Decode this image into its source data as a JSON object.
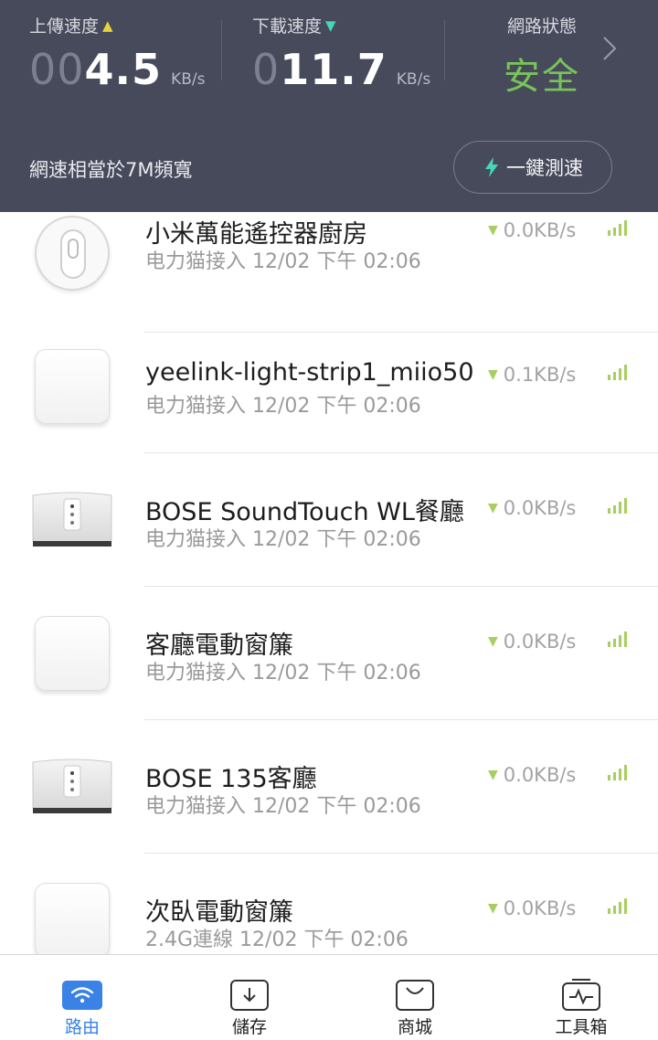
{
  "header": {
    "upload": {
      "label": "上傳速度",
      "value_dim": "00",
      "value": "4.5",
      "unit": "KB/s"
    },
    "download": {
      "label": "下載速度",
      "value_dim": "0",
      "value": "11.7",
      "unit": "KB/s"
    },
    "network": {
      "label": "網路狀態",
      "status": "安全"
    },
    "bandwidth_text": "網速相當於7M頻寬",
    "speedtest_label": "一鍵測速"
  },
  "devices": [
    {
      "name": "小米萬能遙控器廚房",
      "connection": "电力猫接入",
      "time": "12/02 下午 02:06",
      "speed": "0.0KB/s",
      "icon": "remote-icon"
    },
    {
      "name": "yeelink-light-strip1_miio50…",
      "connection": "电力猫接入",
      "time": "12/02 下午 02:06",
      "speed": "0.1KB/s",
      "icon": "smart-device-icon"
    },
    {
      "name": "BOSE SoundTouch WL餐廳",
      "connection": "电力猫接入",
      "time": "12/02 下午 02:06",
      "speed": "0.0KB/s",
      "icon": "speaker-icon"
    },
    {
      "name": "客廳電動窗簾",
      "connection": "电力猫接入",
      "time": "12/02 下午 02:06",
      "speed": "0.0KB/s",
      "icon": "smart-device-icon"
    },
    {
      "name": "BOSE 135客廳",
      "connection": "电力猫接入",
      "time": "12/02 下午 02:06",
      "speed": "0.0KB/s",
      "icon": "speaker-icon"
    },
    {
      "name": "次臥電動窗簾",
      "connection": "2.4G連線",
      "time": "12/02 下午 02:06",
      "speed": "0.0KB/s",
      "icon": "smart-device-icon"
    }
  ],
  "tabs": [
    {
      "label": "路由",
      "icon": "wifi-icon",
      "active": true
    },
    {
      "label": "儲存",
      "icon": "download-box-icon",
      "active": false
    },
    {
      "label": "商城",
      "icon": "shop-bag-icon",
      "active": false
    },
    {
      "label": "工具箱",
      "icon": "toolbox-icon",
      "active": false
    }
  ],
  "colors": {
    "header_bg": "#474a5b",
    "status_safe": "#78c35a",
    "upload_arrow": "#e7d33a",
    "download_arrow": "#47d6b6",
    "active_tab": "#3a82e6",
    "signal": "#a7cf60"
  }
}
